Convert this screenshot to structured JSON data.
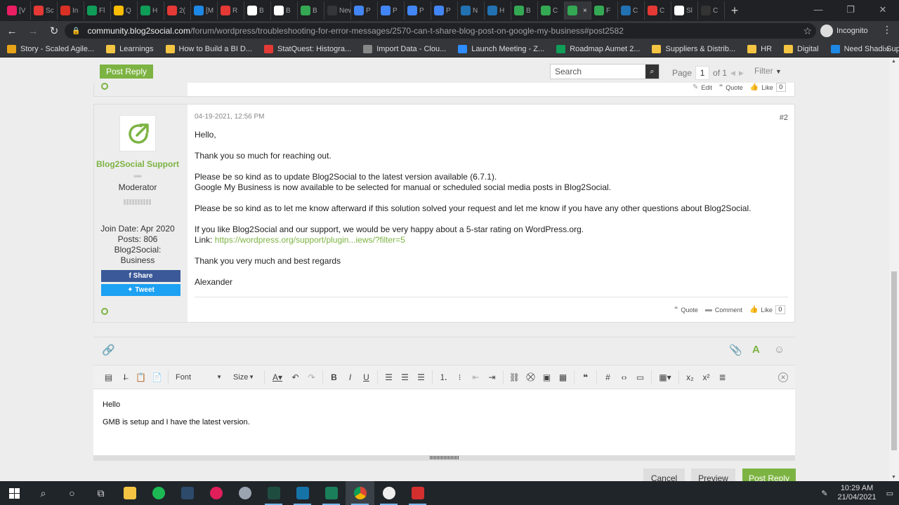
{
  "browser": {
    "tabs": [
      {
        "label": "[V",
        "color": "#e91e63"
      },
      {
        "label": "Sc",
        "color": "#e53935"
      },
      {
        "label": "In",
        "color": "#d93025"
      },
      {
        "label": "Fl",
        "color": "#0f9d58"
      },
      {
        "label": "Q",
        "color": "#fbbc04"
      },
      {
        "label": "H",
        "color": "#0f9d58"
      },
      {
        "label": "2(",
        "color": "#e53935"
      },
      {
        "label": "[M",
        "color": "#1e88e5"
      },
      {
        "label": "R",
        "color": "#e53935"
      },
      {
        "label": "B",
        "color": "#ffffff"
      },
      {
        "label": "B",
        "color": "#ffffff"
      },
      {
        "label": "B",
        "color": "#34a853"
      },
      {
        "label": "New T",
        "color": "#35363a"
      },
      {
        "label": "P",
        "color": "#4285f4"
      },
      {
        "label": "P",
        "color": "#4285f4"
      },
      {
        "label": "P",
        "color": "#4285f4"
      },
      {
        "label": "P",
        "color": "#4285f4"
      },
      {
        "label": "N",
        "color": "#2271b1"
      },
      {
        "label": "H",
        "color": "#2271b1"
      },
      {
        "label": "B",
        "color": "#34a853"
      },
      {
        "label": "C",
        "color": "#34a853"
      },
      {
        "label": "",
        "color": "#34a853"
      },
      {
        "label": "F",
        "color": "#34a853"
      },
      {
        "label": "C",
        "color": "#2271b1"
      },
      {
        "label": "C",
        "color": "#e53935"
      },
      {
        "label": "Sl",
        "color": "#ffffff"
      },
      {
        "label": "C",
        "color": "#333333"
      }
    ],
    "active_tab_index": 21,
    "active_tab_close": "×",
    "new_tab_label": "+",
    "url_host": "community.blog2social.com",
    "url_path": "/forum/wordpress/troubleshooting-for-error-messages/2570-can-t-share-blog-post-on-google-my-business#post2582",
    "profile_label": "Incognito",
    "bookmarks": [
      {
        "label": "Story - Scaled Agile...",
        "color": "#e8a317"
      },
      {
        "label": "Learnings",
        "color": "#f4c542"
      },
      {
        "label": "How to Build a BI D...",
        "color": "#f4c542"
      },
      {
        "label": "StatQuest: Histogra...",
        "color": "#e53935"
      },
      {
        "label": "Import Data - Clou...",
        "color": "#888888"
      },
      {
        "label": "Launch Meeting - Z...",
        "color": "#2d8cff"
      },
      {
        "label": "Roadmap Aumet 2...",
        "color": "#0f9d58"
      },
      {
        "label": "Suppliers & Distrib...",
        "color": "#f4c542"
      },
      {
        "label": "HR",
        "color": "#f4c542"
      },
      {
        "label": "Digital",
        "color": "#f4c542"
      },
      {
        "label": "Need Shadi Suppor...",
        "color": "#1e88e5"
      }
    ],
    "bookmarks_more": "»"
  },
  "forum": {
    "post_reply_label": "Post Reply",
    "search_placeholder": "Search",
    "page_label": "Page",
    "page_current": "1",
    "page_of": "of 1",
    "filter_label": "Filter",
    "prev_post_actions": {
      "edit": "Edit",
      "quote": "Quote",
      "like": "Like",
      "like_count": "0"
    },
    "post": {
      "date": "04-19-2021, 12:56 PM",
      "number": "#2",
      "author": "Blog2Social Support",
      "role": "Moderator",
      "join_date": "Join Date: Apr 2020",
      "posts": "Posts: 806",
      "plan_line1": "Blog2Social:",
      "plan_line2": "Business",
      "share_label": "Share",
      "tweet_label": "Tweet",
      "greeting": "Hello,",
      "line_thanks": "Thank you so much for reaching out.",
      "line_update": "Please be so kind as to update Blog2Social to the latest version available (6.7.1).",
      "line_gmb": "Google My Business is now available to be selected for manual or scheduled social media posts in Blog2Social.",
      "line_feedback": "Please be so kind as to let me know afterward if this solution solved your request and let me know if you have any other questions about Blog2Social.",
      "line_rating": "If you like Blog2Social and our support, we would be very happy about a 5-star rating on WordPress.org.",
      "link_prefix": "Link:",
      "link_text": "https://wordpress.org/support/plugin...iews/?filter=5",
      "line_regards": "Thank you very much and best regards",
      "signature": "Alexander",
      "actions": {
        "quote": "Quote",
        "comment": "Comment",
        "like": "Like",
        "like_count": "0"
      }
    }
  },
  "editor": {
    "font_label": "Font",
    "size_label": "Size",
    "content_line1": "Hello",
    "content_line2": "GMB is setup and I have the latest version.",
    "cancel_label": "Cancel",
    "preview_label": "Preview",
    "submit_label": "Post Reply"
  },
  "taskbar": {
    "time": "10:29 AM",
    "date": "21/04/2021"
  },
  "colors": {
    "accent": "#7cb342",
    "facebook": "#3b5998",
    "twitter": "#1da1f2"
  }
}
